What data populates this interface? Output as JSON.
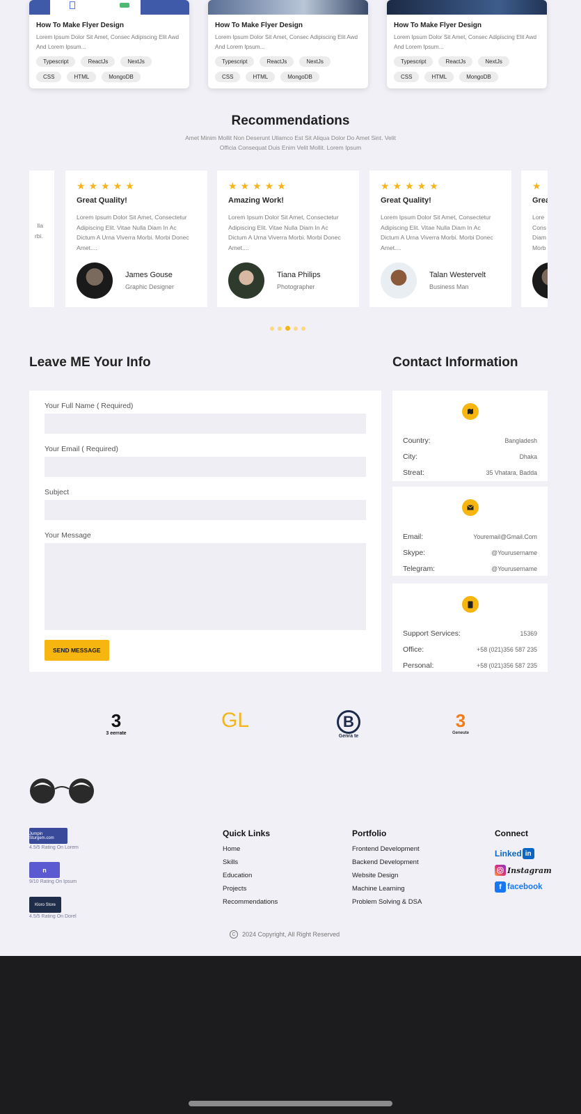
{
  "blog_cards": [
    {
      "title": "How To Make Flyer Design",
      "desc": "Lorem Ipsum Dolor Sit Amet, Consec Adipiscing Elit Awd And Lorem Ipsum...",
      "tags": [
        "Typescript",
        "ReactJs",
        "NextJs",
        "CSS",
        "HTML",
        "MongoDB"
      ]
    },
    {
      "title": "How To Make Flyer Design",
      "desc": "Lorem Ipsum Dolor Sit Amet, Consec Adipiscing Elit Awd And Lorem Ipsum...",
      "tags": [
        "Typescript",
        "ReactJs",
        "NextJs",
        "CSS",
        "HTML",
        "MongoDB"
      ]
    },
    {
      "title": "How To Make Flyer Design",
      "desc": "Lorem Ipsum Dolor Sit Amet, Consec Adipiscing Elit Awd And Lorem Ipsum...",
      "tags": [
        "Typescript",
        "ReactJs",
        "NextJs",
        "CSS",
        "HTML",
        "MongoDB"
      ]
    }
  ],
  "recommendations": {
    "title": "Recommendations",
    "subtitle": "Amet Minim Mollit Non Deserunt Ullamco Est Sit Aliqua Dolor Do Amet Sint. Velit Officia Consequat Duis Enim Velit Mollit. Lorem Ipsum",
    "cards": [
      {
        "stars": "★★★★★",
        "title": "Great Quality!",
        "text": "Lorem Ipsum Dolor Sit Amet, Consectetur Adipiscing Elit. Vitae Nulla Diam In Ac Dictum A Urna Viverra Morbi. Morbi Donec Amet....",
        "name": "James Gouse",
        "role": "Graphic Designer"
      },
      {
        "stars": "★★★★★",
        "title": "Amazing Work!",
        "text": "Lorem Ipsum Dolor Sit Amet, Consectetur Adipiscing Elit. Vitae Nulla Diam In Ac Dictum A Urna Viverra Morbi. Morbi Donec Amet....",
        "name": "Tiana Philips",
        "role": "Photographer"
      },
      {
        "stars": "★★★★★",
        "title": "Great Quality!",
        "text": "Lorem Ipsum Dolor Sit Amet, Consectetur Adipiscing Elit. Vitae Nulla Diam In Ac Dictum A Urna Viverra Morbi. Morbi Donec Amet....",
        "name": "Talan Westervelt",
        "role": "Business Man"
      }
    ],
    "partial_left": {
      "lines": [
        "lla",
        "rbi."
      ]
    },
    "partial_right": {
      "stars": "★ ★",
      "title": "Grea",
      "lines": [
        "Lore",
        "Cons",
        "Diam",
        "Morb"
      ]
    },
    "active_dot": 3,
    "dot_count": 5
  },
  "form": {
    "title": "Leave ME Your Info",
    "fields": [
      {
        "label": "Your Full Name ( Required)"
      },
      {
        "label": "Your Email ( Required)"
      },
      {
        "label": "Subject"
      }
    ],
    "message_label": "Your Message",
    "submit_label": "SEND MESSAGE"
  },
  "contact": {
    "title": "Contact Information",
    "cards": [
      {
        "icon": "map-icon",
        "rows": [
          {
            "k": "Country:",
            "v": "Bangladesh"
          },
          {
            "k": "City:",
            "v": "Dhaka"
          },
          {
            "k": "Streat:",
            "v": "35 Vhatara, Badda"
          }
        ]
      },
      {
        "icon": "mail-icon",
        "rows": [
          {
            "k": "Email:",
            "v": "Youremail@Gmail.Com"
          },
          {
            "k": "Skype:",
            "v": "@Yourusername"
          },
          {
            "k": "Telegram:",
            "v": "@Yourusername"
          }
        ]
      },
      {
        "icon": "phone-icon",
        "rows": [
          {
            "k": "Support Services:",
            "v": "15369"
          },
          {
            "k": "Office:",
            "v": "+58 (021)356 587 235"
          },
          {
            "k": "Personal:",
            "v": "+58 (021)356 587 235"
          }
        ]
      }
    ]
  },
  "partner_logos": [
    {
      "mark": "3",
      "sub": "3 eerrate"
    },
    {
      "mark": "GL",
      "sub": ""
    },
    {
      "mark": "B",
      "sub": "Genra te"
    },
    {
      "mark": "3",
      "sub": "Geneute"
    }
  ],
  "ratings": [
    {
      "badge": "Jumpin Sturgem.com",
      "caption": "4.5/5 Rating On Lorem"
    },
    {
      "badge": "n",
      "caption": "9/10 Rating On Ipsum"
    },
    {
      "badge": "Kloro Store",
      "caption": "4.5/5 Rating On Dorel"
    }
  ],
  "footer": {
    "quick_links": {
      "title": "Quick Links",
      "items": [
        "Home",
        "Skills",
        "Education",
        "Projects",
        "Recommendations"
      ]
    },
    "portfolio": {
      "title": "Portfolio",
      "items": [
        "Frontend Development",
        "Backend Development",
        "Website Design",
        "Machine Learning",
        "Problem Solving & DSA"
      ]
    },
    "connect": {
      "title": "Connect",
      "linkedin": "Linked",
      "linkedin_box": "in",
      "instagram": "Instagram",
      "facebook_box": "f",
      "facebook": "facebook"
    },
    "copyright_symbol": "C",
    "copyright": "2024 Copyright, All Right Reserved"
  },
  "colors": {
    "accent": "#f7b510",
    "page_bg": "#f0f0f6",
    "dark_bg": "#1c1c1e"
  }
}
